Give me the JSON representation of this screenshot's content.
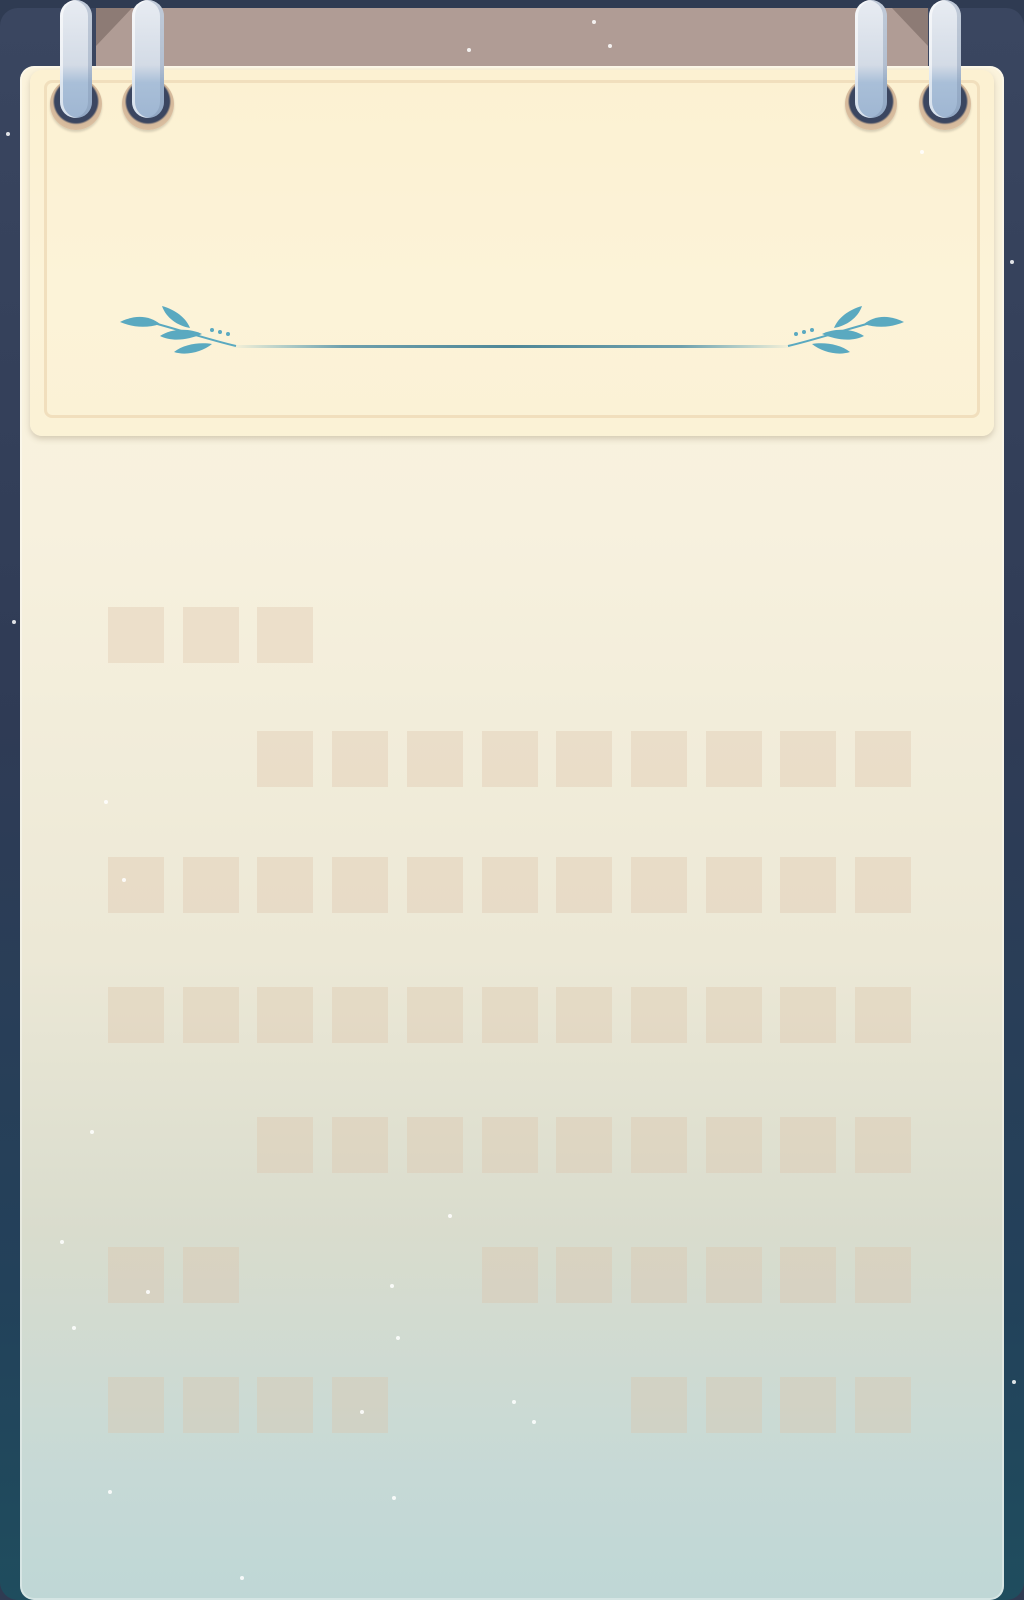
{
  "colors": {
    "frame": "#2f3b52",
    "paper_top": "#fbf3dc",
    "paper_bottom": "#bfd7d6",
    "cell_fill": "rgba(220,196,168,0.35)",
    "leaf": "#5aa9c0"
  },
  "header": {
    "rings": [
      "ring-icon",
      "ring-icon",
      "ring-icon",
      "ring-icon"
    ],
    "ornament": "laurel-divider-icon"
  },
  "grid": {
    "rows": [
      [
        1,
        1,
        1,
        0,
        0,
        0,
        0,
        0,
        0,
        0,
        0
      ],
      [
        0,
        0,
        1,
        1,
        1,
        1,
        1,
        1,
        1,
        1,
        1
      ],
      [
        1,
        1,
        1,
        1,
        1,
        1,
        1,
        1,
        1,
        1,
        1
      ],
      [
        1,
        1,
        1,
        1,
        1,
        1,
        1,
        1,
        1,
        1,
        1
      ],
      [
        0,
        0,
        1,
        1,
        1,
        1,
        1,
        1,
        1,
        1,
        1
      ],
      [
        1,
        1,
        0,
        0,
        0,
        1,
        1,
        1,
        1,
        1,
        1
      ],
      [
        1,
        1,
        1,
        1,
        0,
        0,
        0,
        1,
        1,
        1,
        1
      ]
    ]
  }
}
